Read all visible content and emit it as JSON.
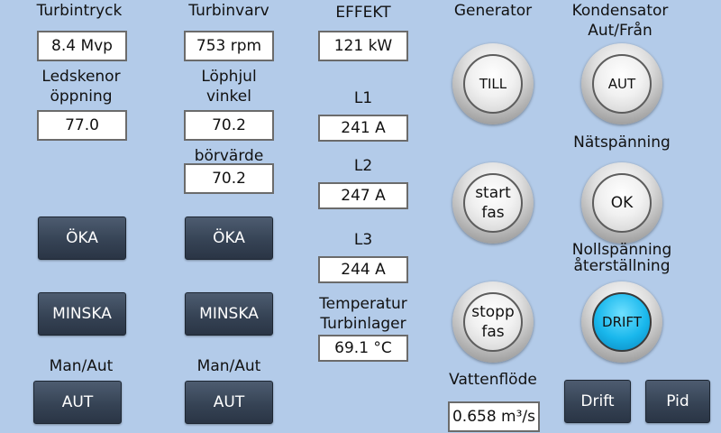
{
  "col1": {
    "title": "Turbintryck",
    "pressure": "8.4 Mvp",
    "guide_label_1": "Ledskenor",
    "guide_label_2": "öppning",
    "guide_value": "77.0",
    "increase": "ÖKA",
    "decrease": "MINSKA",
    "mode_label": "Man/Aut",
    "mode_button": "AUT"
  },
  "col2": {
    "title": "Turbinvarv",
    "speed": "753 rpm",
    "runner_label_1": "Löphjul",
    "runner_label_2": "vinkel",
    "runner_value": "70.2",
    "setpoint_label": "börvärde",
    "setpoint_value": "70.2",
    "increase": "ÖKA",
    "decrease": "MINSKA",
    "mode_label": "Man/Aut",
    "mode_button": "AUT"
  },
  "col3": {
    "power_label": "EFFEKT",
    "power_value": "121 kW",
    "l1_label": "L1",
    "l1_value": "241 A",
    "l2_label": "L2",
    "l2_value": "247 A",
    "l3_label": "L3",
    "l3_value": "244 A",
    "temp_label_1": "Temperatur",
    "temp_label_2": "Turbinlager",
    "temp_value": "69.1 °C"
  },
  "col4": {
    "generator_label": "Generator",
    "generator_button": "TILL",
    "start_phase_1": "start",
    "start_phase_2": "fas",
    "stop_phase_1": "stopp",
    "stop_phase_2": "fas",
    "flow_label": "Vattenflöde",
    "flow_value": "0.658 m³/s"
  },
  "col5": {
    "condenser_label_1": "Kondensator",
    "condenser_label_2": "Aut/Från",
    "condenser_button": "AUT",
    "grid_voltage_label": "Nätspänning",
    "grid_voltage_button": "OK",
    "zero_voltage_label_1": "Nollspänning",
    "zero_voltage_label_2": "återställning",
    "zero_voltage_button": "DRIFT",
    "drift_button": "Drift",
    "pid_button": "Pid"
  },
  "colors": {
    "background": "#b3cbe9",
    "button_dark": "#364355",
    "indicator_active": "#19b7ec"
  }
}
